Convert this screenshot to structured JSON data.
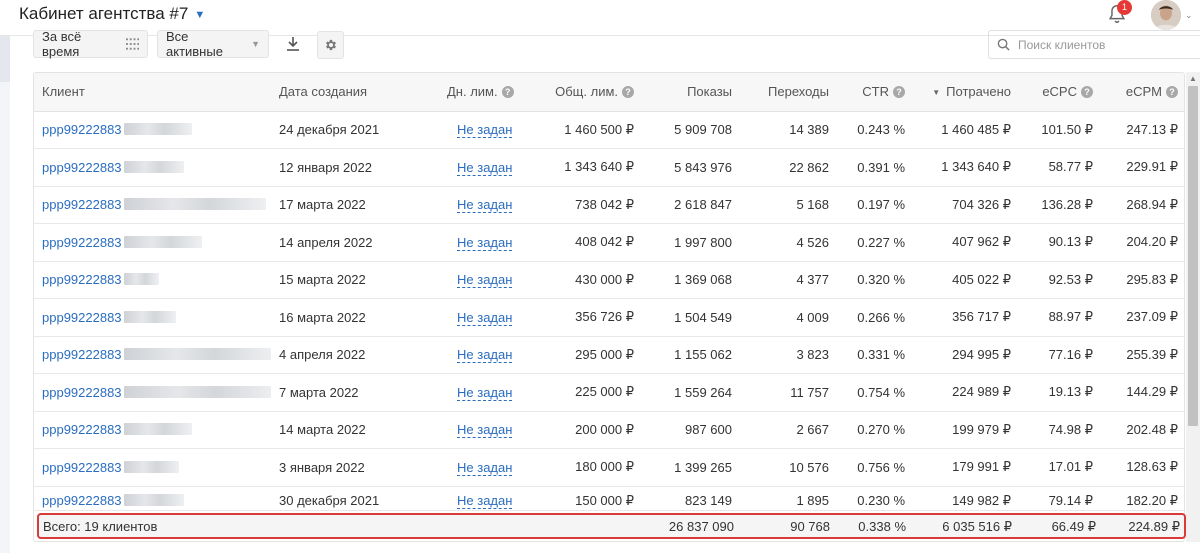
{
  "header": {
    "title": "Кабинет агентства #7",
    "notifications_count": "1"
  },
  "toolbar": {
    "period_label": "За всё время",
    "filter_label": "Все активные",
    "search_placeholder": "Поиск клиентов"
  },
  "table": {
    "columns": {
      "client": "Клиент",
      "created": "Дата создания",
      "daily_limit": "Дн. лим.",
      "total_limit": "Общ. лим.",
      "impressions": "Показы",
      "clicks": "Переходы",
      "ctr": "CTR",
      "spent": "Потрачено",
      "ecpc": "eCPC",
      "ecpm": "eCPM"
    },
    "rows": [
      {
        "client": "ppp99222883",
        "created": "24 декабря 2021",
        "daily_limit": "Не задан",
        "total_limit": "1 460 500 ₽",
        "impressions": "5 909 708",
        "clicks": "14 389",
        "ctr": "0.243 %",
        "spent": "1 460 485 ₽",
        "ecpc": "101.50 ₽",
        "ecpm": "247.13 ₽"
      },
      {
        "client": "ppp99222883",
        "created": "12 января 2022",
        "daily_limit": "Не задан",
        "total_limit": "1 343 640 ₽",
        "impressions": "5 843 976",
        "clicks": "22 862",
        "ctr": "0.391 %",
        "spent": "1 343 640 ₽",
        "ecpc": "58.77 ₽",
        "ecpm": "229.91 ₽"
      },
      {
        "client": "ppp99222883",
        "created": "17 марта 2022",
        "daily_limit": "Не задан",
        "total_limit": "738 042 ₽",
        "impressions": "2 618 847",
        "clicks": "5 168",
        "ctr": "0.197 %",
        "spent": "704 326 ₽",
        "ecpc": "136.28 ₽",
        "ecpm": "268.94 ₽"
      },
      {
        "client": "ppp99222883",
        "created": "14 апреля 2022",
        "daily_limit": "Не задан",
        "total_limit": "408 042 ₽",
        "impressions": "1 997 800",
        "clicks": "4 526",
        "ctr": "0.227 %",
        "spent": "407 962 ₽",
        "ecpc": "90.13 ₽",
        "ecpm": "204.20 ₽"
      },
      {
        "client": "ppp99222883",
        "created": "15 марта 2022",
        "daily_limit": "Не задан",
        "total_limit": "430 000 ₽",
        "impressions": "1 369 068",
        "clicks": "4 377",
        "ctr": "0.320 %",
        "spent": "405 022 ₽",
        "ecpc": "92.53 ₽",
        "ecpm": "295.83 ₽"
      },
      {
        "client": "ppp99222883",
        "created": "16 марта 2022",
        "daily_limit": "Не задан",
        "total_limit": "356 726 ₽",
        "impressions": "1 504 549",
        "clicks": "4 009",
        "ctr": "0.266 %",
        "spent": "356 717 ₽",
        "ecpc": "88.97 ₽",
        "ecpm": "237.09 ₽"
      },
      {
        "client": "ppp99222883",
        "created": "4 апреля 2022",
        "daily_limit": "Не задан",
        "total_limit": "295 000 ₽",
        "impressions": "1 155 062",
        "clicks": "3 823",
        "ctr": "0.331 %",
        "spent": "294 995 ₽",
        "ecpc": "77.16 ₽",
        "ecpm": "255.39 ₽"
      },
      {
        "client": "ppp99222883",
        "created": "7 марта 2022",
        "daily_limit": "Не задан",
        "total_limit": "225 000 ₽",
        "impressions": "1 559 264",
        "clicks": "11 757",
        "ctr": "0.754 %",
        "spent": "224 989 ₽",
        "ecpc": "19.13 ₽",
        "ecpm": "144.29 ₽"
      },
      {
        "client": "ppp99222883",
        "created": "14 марта 2022",
        "daily_limit": "Не задан",
        "total_limit": "200 000 ₽",
        "impressions": "987 600",
        "clicks": "2 667",
        "ctr": "0.270 %",
        "spent": "199 979 ₽",
        "ecpc": "74.98 ₽",
        "ecpm": "202.48 ₽"
      },
      {
        "client": "ppp99222883",
        "created": "3 января 2022",
        "daily_limit": "Не задан",
        "total_limit": "180 000 ₽",
        "impressions": "1 399 265",
        "clicks": "10 576",
        "ctr": "0.756 %",
        "spent": "179 991 ₽",
        "ecpc": "17.01 ₽",
        "ecpm": "128.63 ₽"
      },
      {
        "client": "ppp99222883",
        "created": "30 декабря 2021",
        "daily_limit": "Не задан",
        "total_limit": "150 000 ₽",
        "impressions": "823 149",
        "clicks": "1 895",
        "ctr": "0.230 %",
        "spent": "149 982 ₽",
        "ecpc": "79.14 ₽",
        "ecpm": "182.20 ₽"
      }
    ],
    "totals": {
      "label": "Всего: 19 клиентов",
      "impressions": "26 837 090",
      "clicks": "90 768",
      "ctr": "0.338 %",
      "spent": "6 035 516 ₽",
      "ecpc": "66.49 ₽",
      "ecpm": "224.89 ₽"
    }
  }
}
